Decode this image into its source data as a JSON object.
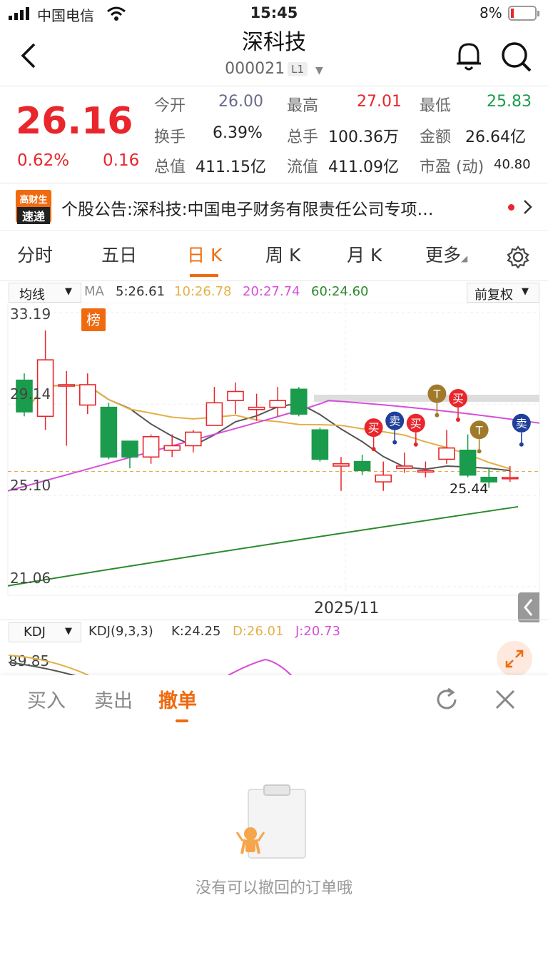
{
  "status_bar": {
    "carrier": "中国电信",
    "time": "15:45",
    "battery": "8%"
  },
  "header": {
    "title": "深科技",
    "code": "000021",
    "level_badge": "L1"
  },
  "quote": {
    "price": "26.16",
    "change_pct": "0.62%",
    "change": "0.16",
    "stats": [
      {
        "label": "今开",
        "value": "26.00"
      },
      {
        "label": "最高",
        "value": "27.01"
      },
      {
        "label": "最低",
        "value": "25.83"
      },
      {
        "label": "换手",
        "value": "6.39%"
      },
      {
        "label": "总手",
        "value": "100.36万"
      },
      {
        "label": "金额",
        "value": "26.64亿"
      },
      {
        "label": "总值",
        "value": "411.15亿"
      },
      {
        "label": "流值",
        "value": "411.09亿"
      },
      {
        "label": "市盈 (动)",
        "value": "40.80"
      }
    ]
  },
  "news": {
    "logo_top": "高财生",
    "logo_bottom": "速递",
    "text": "个股公告:深科技:中国电子财务有限责任公司专项…"
  },
  "chart_tabs": [
    "分时",
    "五日",
    "日 K",
    "周 K",
    "月 K",
    "更多"
  ],
  "chart_tab_active": "日 K",
  "kline": {
    "ma_selector": "均线",
    "ma_label": "MA",
    "ma5": "5:26.61",
    "ma10": "10:26.78",
    "ma20": "20:27.74",
    "ma60": "60:24.60",
    "adjust": "前复权",
    "y_ticks": [
      "33.19",
      "29.14",
      "25.10",
      "21.06"
    ],
    "bang_badge": "榜",
    "low_label": "25.44",
    "x_label": "2025/11",
    "markers": [
      "买",
      "卖",
      "买",
      "T",
      "买",
      "T",
      "卖"
    ]
  },
  "kdj": {
    "selector": "KDJ",
    "params": "KDJ(9,3,3)",
    "k": "K:24.25",
    "d": "D:26.01",
    "j": "J:20.73",
    "y_tick": "89.85"
  },
  "trade_panel": {
    "tabs": [
      "买入",
      "卖出",
      "撤单"
    ],
    "active": "撤单",
    "empty_text": "没有可以撤回的订单哦"
  },
  "colors": {
    "up": "#e8262c",
    "down": "#1a9c4c",
    "accent": "#f06a0f",
    "ma5": "#555555",
    "ma10": "#e3b047",
    "ma20": "#d64fd8",
    "ma60": "#2a8a2a"
  },
  "chart_data": {
    "type": "candlestick",
    "x_label": "2025/11",
    "y_ticks": [
      33.19,
      29.14,
      25.1,
      21.06
    ],
    "ylim": [
      21.06,
      33.19
    ],
    "candles": [
      {
        "o": 30.2,
        "c": 28.8,
        "h": 30.5,
        "l": 28.6
      },
      {
        "o": 28.6,
        "c": 31.1,
        "h": 32.4,
        "l": 28.0
      },
      {
        "o": 30.0,
        "c": 30.0,
        "h": 30.6,
        "l": 27.3
      },
      {
        "o": 29.1,
        "c": 30.0,
        "h": 30.5,
        "l": 28.7
      },
      {
        "o": 29.0,
        "c": 26.8,
        "h": 29.2,
        "l": 26.7
      },
      {
        "o": 27.5,
        "c": 26.8,
        "h": 27.5,
        "l": 26.3
      },
      {
        "o": 26.8,
        "c": 27.7,
        "h": 27.8,
        "l": 26.5
      },
      {
        "o": 27.1,
        "c": 27.3,
        "h": 27.8,
        "l": 26.8
      },
      {
        "o": 27.3,
        "c": 27.9,
        "h": 28.0,
        "l": 27.0
      },
      {
        "o": 28.2,
        "c": 29.2,
        "h": 29.9,
        "l": 28.2
      },
      {
        "o": 29.3,
        "c": 29.7,
        "h": 30.1,
        "l": 28.7
      },
      {
        "o": 28.9,
        "c": 29.0,
        "h": 29.6,
        "l": 28.4
      },
      {
        "o": 29.0,
        "c": 29.3,
        "h": 29.9,
        "l": 28.6
      },
      {
        "o": 29.8,
        "c": 28.7,
        "h": 29.9,
        "l": 28.6
      },
      {
        "o": 28.0,
        "c": 26.7,
        "h": 28.1,
        "l": 26.6
      },
      {
        "o": 26.4,
        "c": 26.5,
        "h": 26.8,
        "l": 25.3
      },
      {
        "o": 26.6,
        "c": 26.2,
        "h": 26.9,
        "l": 26.0
      },
      {
        "o": 25.7,
        "c": 26.0,
        "h": 26.6,
        "l": 25.3
      },
      {
        "o": 26.3,
        "c": 26.4,
        "h": 27.0,
        "l": 26.1
      },
      {
        "o": 26.2,
        "c": 26.2,
        "h": 26.6,
        "l": 25.9
      },
      {
        "o": 26.7,
        "c": 27.2,
        "h": 28.0,
        "l": 26.5
      },
      {
        "o": 27.1,
        "c": 26.0,
        "h": 27.8,
        "l": 25.9
      },
      {
        "o": 25.9,
        "c": 25.7,
        "h": 26.3,
        "l": 25.44
      },
      {
        "o": 25.9,
        "c": 25.9,
        "h": 26.4,
        "l": 25.7
      }
    ],
    "ma5_label": "5:26.61",
    "ma10_label": "10:26.78",
    "ma20_label": "20:27.74",
    "ma60_label": "60:24.60"
  }
}
